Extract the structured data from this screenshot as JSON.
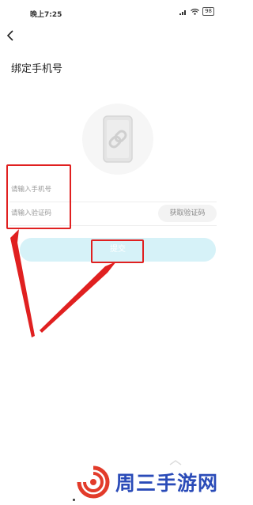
{
  "status_bar": {
    "time": "晚上7:25",
    "battery": "98",
    "icons": [
      "signal-icon",
      "wifi-icon",
      "battery-icon"
    ]
  },
  "header": {
    "back_icon": "chevron-left-icon",
    "title": "绑定手机号"
  },
  "form": {
    "phone_placeholder": "请输入手机号",
    "code_placeholder": "请输入验证码",
    "get_code_label": "获取验证码",
    "submit_label": "提交"
  },
  "illustration": {
    "icon": "phone-link-icon"
  },
  "watermark": {
    "text": "周三手游网"
  },
  "colors": {
    "submit_bg": "#d6f2f8",
    "annotation_red": "#e02020",
    "watermark_blue": "#2a4bb8"
  }
}
